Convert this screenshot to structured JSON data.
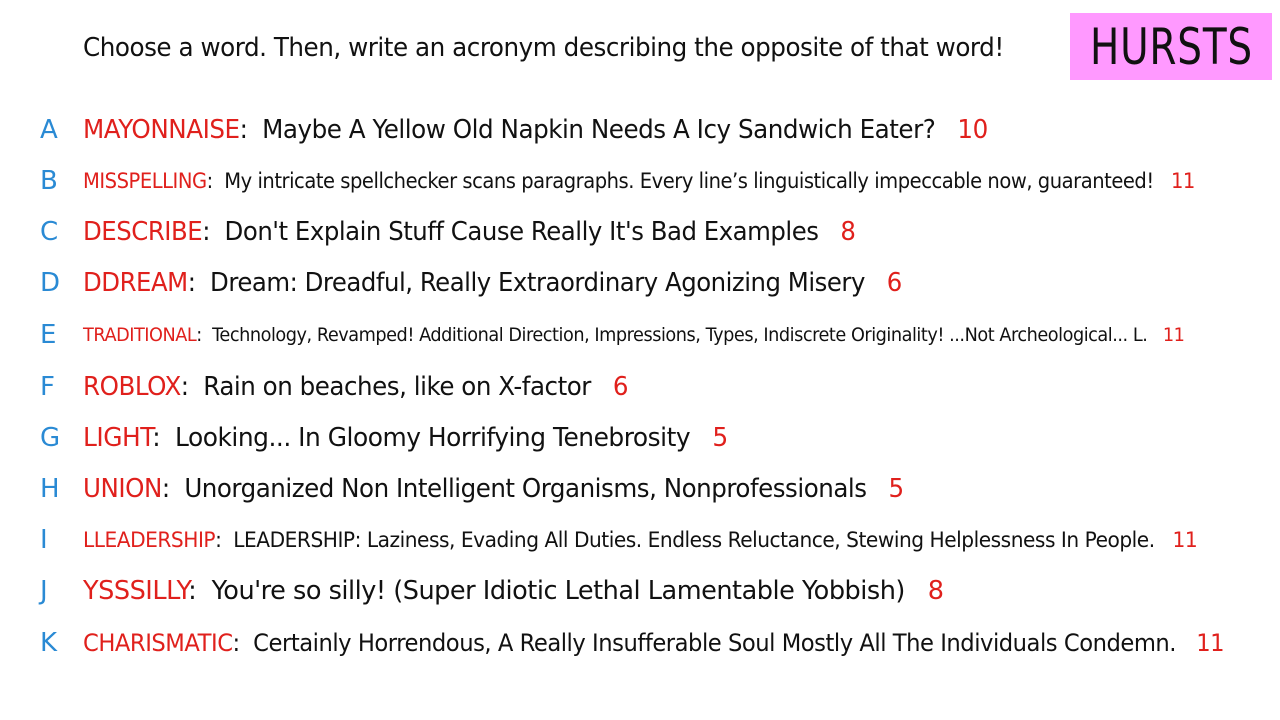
{
  "prompt": "Choose a word. Then, write an acronym describing the opposite of that word!",
  "brand": "HURSTS",
  "colors": {
    "letter": "#2a8ad4",
    "word": "#e0201c",
    "count": "#e0201c",
    "text": "#111111",
    "brand_bg": "#ff99ff"
  },
  "rows": [
    {
      "letter": "A",
      "word": "MAYONNAISE",
      "acronym": "Maybe A Yellow Old Napkin Needs A Icy Sandwich Eater?",
      "count": "10"
    },
    {
      "letter": "B",
      "word": "MISSPELLING",
      "acronym": "My intricate spellchecker scans paragraphs. Every line’s linguistically impeccable now, guaranteed!",
      "count": "11"
    },
    {
      "letter": "C",
      "word": "DESCRIBE",
      "acronym": "Don't Explain Stuff Cause Really It's Bad Examples",
      "count": "8"
    },
    {
      "letter": "D",
      "word": "DDREAM",
      "acronym": "Dream: Dreadful, Really Extraordinary Agonizing Misery",
      "count": "6"
    },
    {
      "letter": "E",
      "word": "TRADITIONAL",
      "acronym": "Technology, Revamped! Additional Direction, Impressions, Types, Indiscrete Originality! ...Not Archeological... L.",
      "count": "11"
    },
    {
      "letter": "F",
      "word": "ROBLOX",
      "acronym": "Rain on beaches, like on X-factor",
      "count": "6"
    },
    {
      "letter": "G",
      "word": "LIGHT",
      "acronym": "Looking... In Gloomy Horrifying Tenebrosity",
      "count": "5"
    },
    {
      "letter": "H",
      "word": "UNION",
      "acronym": "Unorganized Non Intelligent Organisms, Nonprofessionals",
      "count": "5"
    },
    {
      "letter": "I",
      "word": "LLEADERSHIP",
      "acronym": "LEADERSHIP: Laziness, Evading All Duties. Endless Reluctance, Stewing Helplessness In People.",
      "count": "11"
    },
    {
      "letter": "J",
      "word": "YSSSILLY",
      "acronym": "You're so silly! (Super Idiotic Lethal Lamentable Yobbish)",
      "count": "8"
    },
    {
      "letter": "K",
      "word": "CHARISMATIC",
      "acronym": "Certainly Horrendous, A Really Insufferable Soul Mostly All The Individuals Condemn.",
      "count": "11"
    }
  ]
}
